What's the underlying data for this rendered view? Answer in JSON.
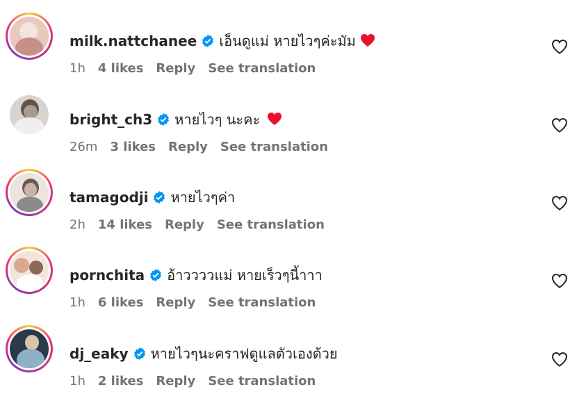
{
  "comments": [
    {
      "username": "milk.nattchanee",
      "text": "เอ็นดูแม่ หายไวๆค่ะมัม",
      "emoji": "red-heart",
      "time": "1h",
      "likes": "4 likes",
      "reply": "Reply",
      "translate": "See translation",
      "ring": true,
      "avatar_colors": [
        "#e9c8c0",
        "#f4e4dc",
        "#c78f86"
      ]
    },
    {
      "username": "bright_ch3",
      "text": "หายไวๆ นะคะ",
      "emoji": "red-heart",
      "time": "26m",
      "likes": "3 likes",
      "reply": "Reply",
      "translate": "See translation",
      "ring": false,
      "avatar_colors": [
        "#d7d3ce",
        "#a89c90",
        "#5e544c"
      ]
    },
    {
      "username": "tamagodji",
      "text": "หายไวๆค่า",
      "emoji": "",
      "time": "2h",
      "likes": "14 likes",
      "reply": "Reply",
      "translate": "See translation",
      "ring": true,
      "avatar_colors": [
        "#ece4de",
        "#c9b3a6",
        "#6b5a50"
      ]
    },
    {
      "username": "pornchita",
      "text": "อ้าววววแม่ หายเร็วๆนี้าาา",
      "emoji": "",
      "time": "1h",
      "likes": "6 likes",
      "reply": "Reply",
      "translate": "See translation",
      "ring": true,
      "avatar_colors": [
        "#f2e6dc",
        "#d9a88e",
        "#8a6a58"
      ]
    },
    {
      "username": "dj_eaky",
      "text": "หายไวๆนะคราฟดูแลตัวเองด้วย",
      "emoji": "",
      "time": "1h",
      "likes": "2 likes",
      "reply": "Reply",
      "translate": "See translation",
      "ring": true,
      "avatar_colors": [
        "#2b3a4a",
        "#8fb0c8",
        "#d9c6a8"
      ]
    }
  ],
  "colors": {
    "verified": "#0095f6",
    "muted": "#737373",
    "heart_emoji": "#e8132b"
  },
  "icons": {
    "verified": "verified-badge-icon",
    "like": "heart-outline-icon"
  }
}
